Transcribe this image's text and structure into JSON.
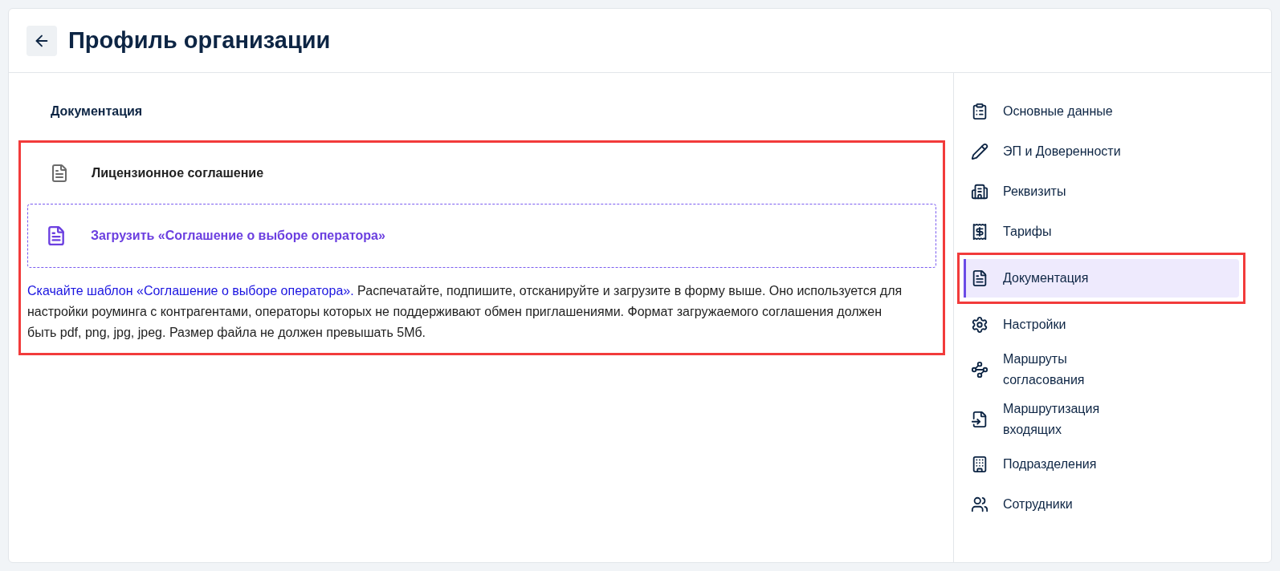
{
  "header": {
    "title": "Профиль организации"
  },
  "section": {
    "title": "Документация"
  },
  "documents": [
    {
      "title": "Лицензионное соглашение"
    }
  ],
  "upload": {
    "label": "Загрузить «Соглашение о выборе оператора»"
  },
  "note": {
    "link": "Скачайте шаблон «Соглашение о выборе оператора».",
    "text": " Распечатайте, подпишите, отсканируйте и загрузите в форму выше. Оно используется для настройки роуминга с контрагентами, операторы которых не поддерживают обмен приглашениями. Формат загружаемого соглашения должен быть pdf, png, jpg, jpeg. Размер файла не должен превышать 5Мб."
  },
  "sidebar": {
    "items": [
      {
        "label": "Основные данные",
        "selected": false
      },
      {
        "label": "ЭП и Доверенности",
        "selected": false
      },
      {
        "label": "Реквизиты",
        "selected": false
      },
      {
        "label": "Тарифы",
        "selected": false
      },
      {
        "label": "Документация",
        "selected": true
      },
      {
        "label": "Настройки",
        "selected": false
      },
      {
        "label": "Маршруты согласования",
        "selected": false
      },
      {
        "label": "Маршрутизация входящих",
        "selected": false
      },
      {
        "label": "Подразделения",
        "selected": false
      },
      {
        "label": "Сотрудники",
        "selected": false
      }
    ]
  }
}
